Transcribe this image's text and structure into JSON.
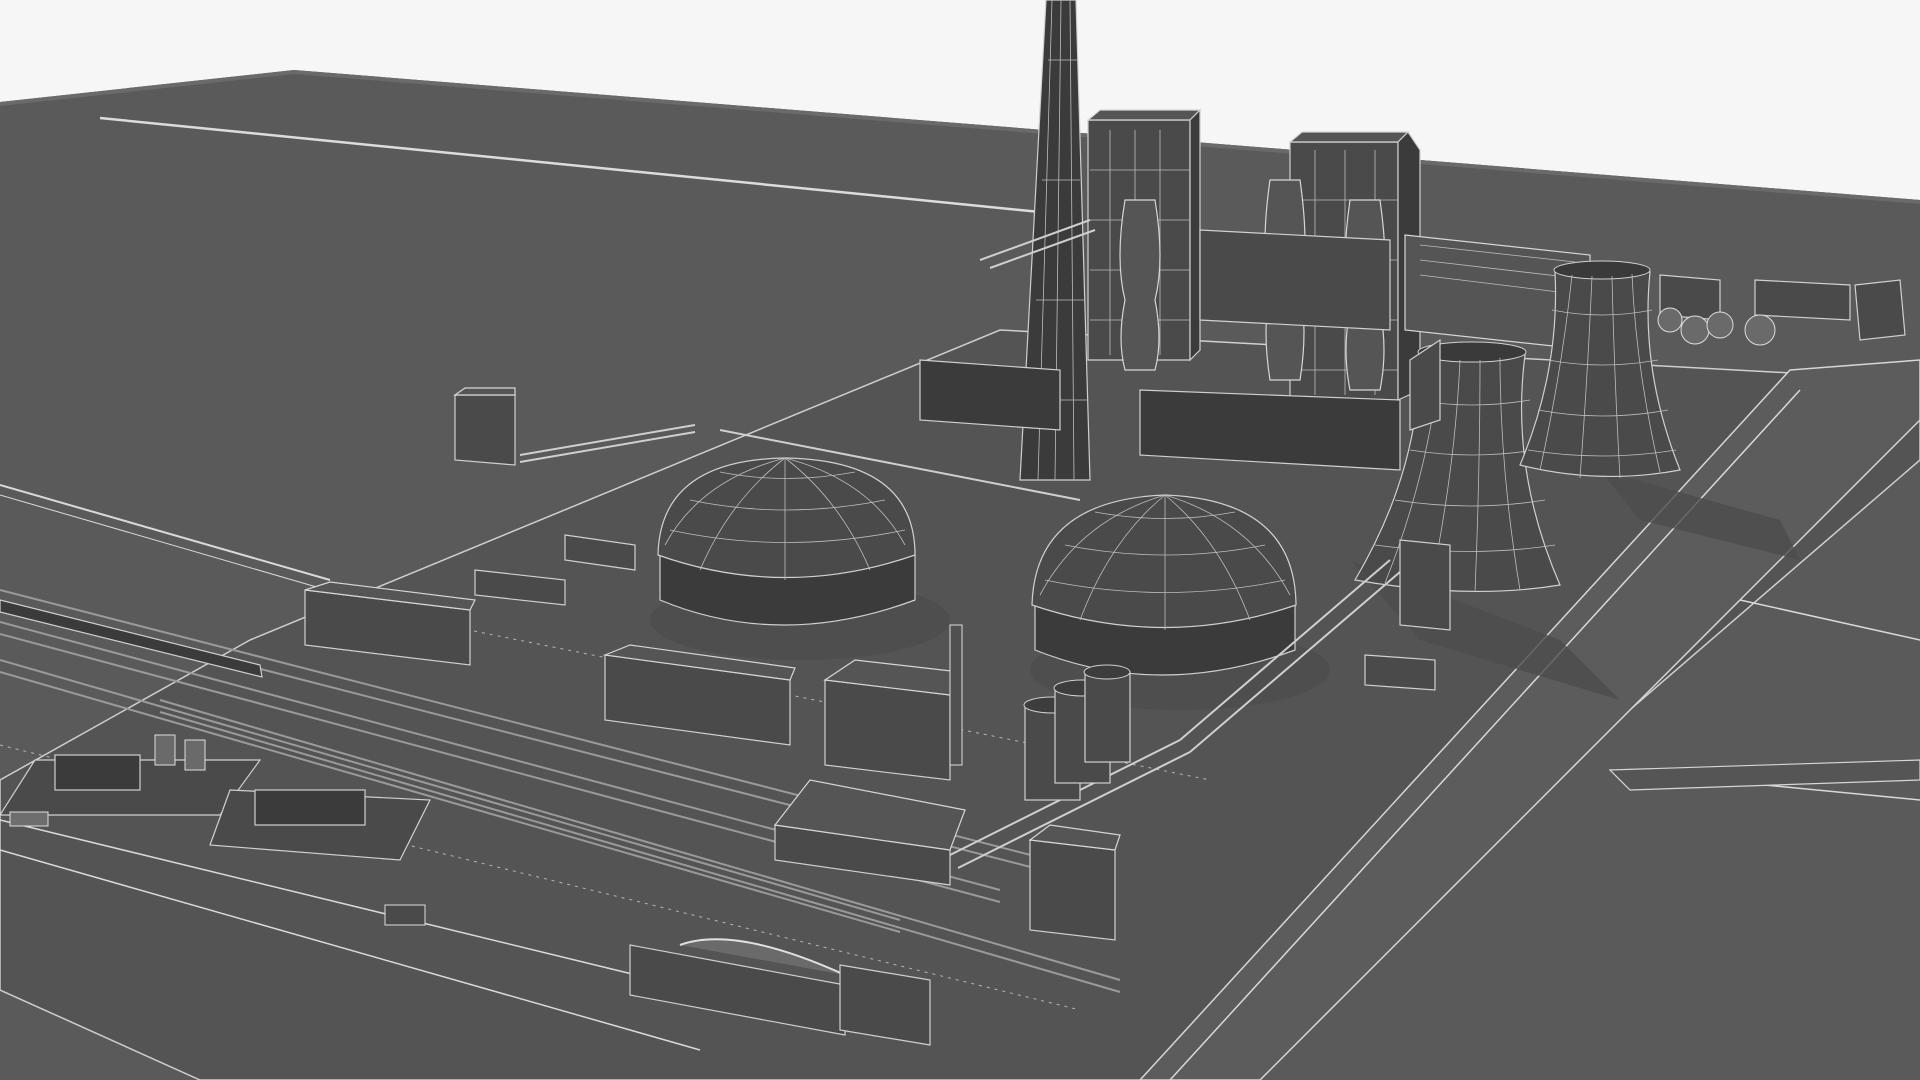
{
  "scene": {
    "kind": "3d-render",
    "subject": "",
    "colors": {
      "sky": "#f6f6f6",
      "ground": "#595959",
      "building": "#4a4a4a",
      "wire": "#d9d9d9"
    },
    "counts": {
      "cooling_towers": 2,
      "coal_domes": 2,
      "boiler_towers": 2,
      "chimneys": 1,
      "silos": 3
    }
  }
}
